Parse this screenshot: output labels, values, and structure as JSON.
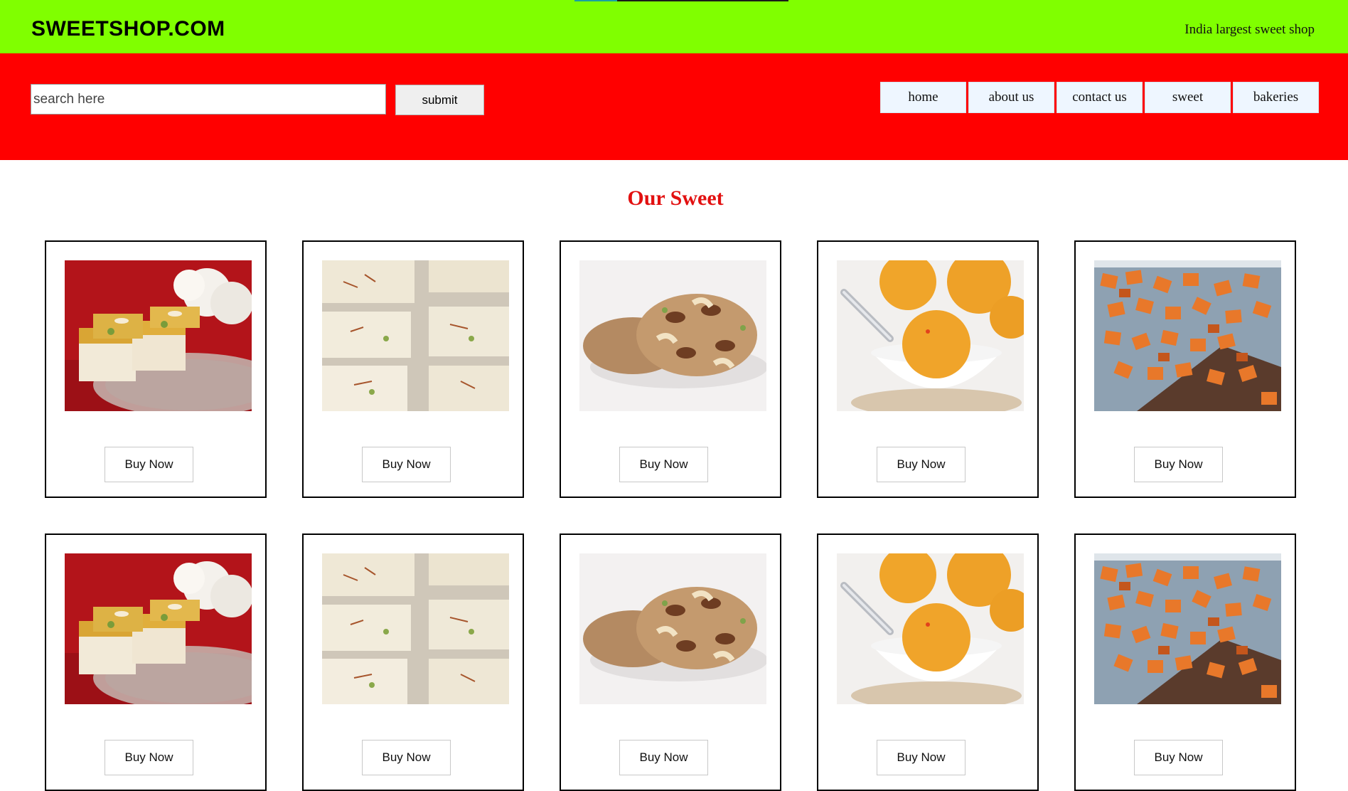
{
  "header": {
    "brand": "SWEETSHOP.COM",
    "tagline": "India largest sweet shop"
  },
  "search": {
    "placeholder": "search here",
    "value": "",
    "submit_label": "submit"
  },
  "nav": {
    "items": [
      {
        "label": "home"
      },
      {
        "label": "about us"
      },
      {
        "label": "contact us"
      },
      {
        "label": "sweet"
      },
      {
        "label": "bakeries"
      }
    ]
  },
  "section": {
    "title": "Our Sweet"
  },
  "products": [
    {
      "image": "mawa-barfi-photo",
      "button": "Buy Now"
    },
    {
      "image": "milk-barfi-photo",
      "button": "Buy Now"
    },
    {
      "image": "dry-fruit-cookie-photo",
      "button": "Buy Now"
    },
    {
      "image": "boondi-laddu-photo",
      "button": "Buy Now"
    },
    {
      "image": "sweet-cubes-photo",
      "button": "Buy Now"
    },
    {
      "image": "mawa-barfi-photo",
      "button": "Buy Now"
    },
    {
      "image": "milk-barfi-photo",
      "button": "Buy Now"
    },
    {
      "image": "dry-fruit-cookie-photo",
      "button": "Buy Now"
    },
    {
      "image": "boondi-laddu-photo",
      "button": "Buy Now"
    },
    {
      "image": "sweet-cubes-photo",
      "button": "Buy Now"
    }
  ],
  "colors": {
    "topbar": "#80ff00",
    "navbar": "#ff0000",
    "title": "#e21010"
  }
}
